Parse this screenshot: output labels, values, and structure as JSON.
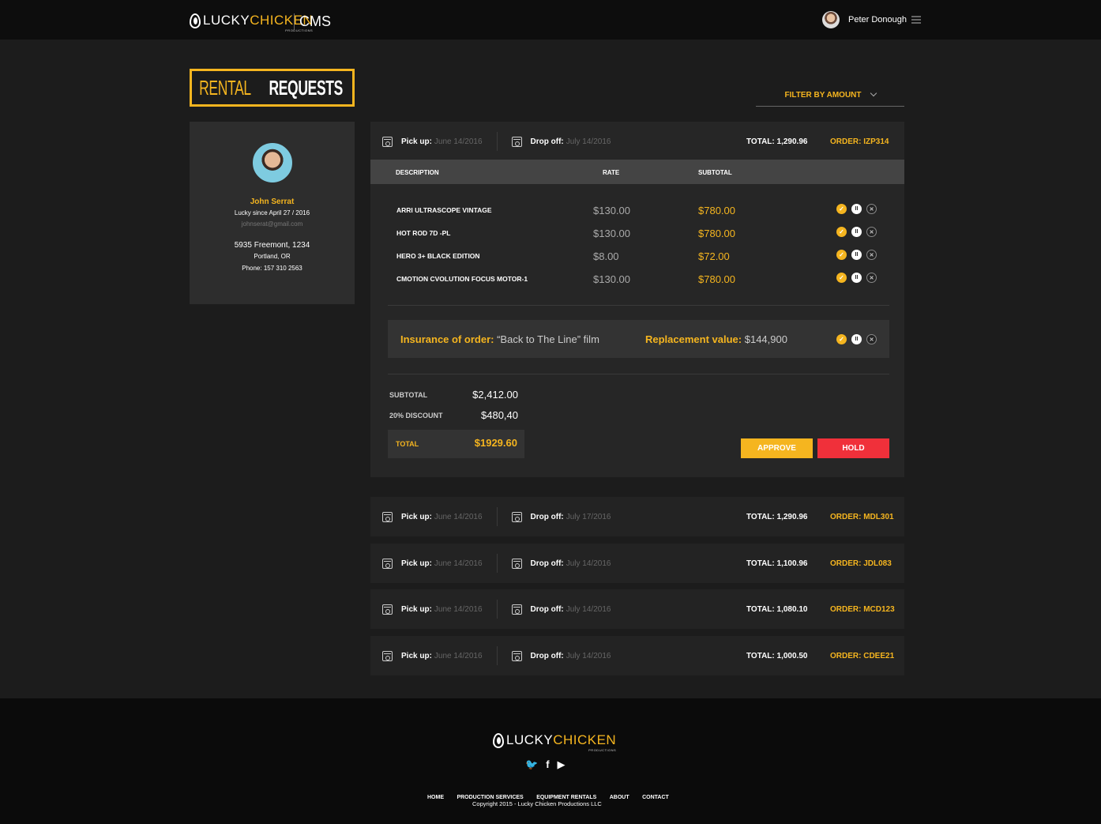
{
  "nav": {
    "logo_lucky": "LUCKY",
    "logo_chicken": "CHICKEN",
    "logo_productions": "PRODUCTIONS",
    "cms": "CMS",
    "user_name": "Peter Donough"
  },
  "page": {
    "title_light": "RENTAL",
    "title_bold": "REQUESTS",
    "filter_label": "FILTER BY AMOUNT"
  },
  "customer": {
    "name": "John Serrat",
    "since": "Lucky since April 27 / 2016",
    "email": "johnserat@gmail.com",
    "address": "5935 Freemont, 1234",
    "city": "Portland, OR",
    "phone": "Phone: 157 310 2563"
  },
  "labels": {
    "pickup": "Pick up:",
    "dropoff": "Drop off:",
    "desc": "DESCRIPTION",
    "rate": "RATE",
    "subtotal": "SUBTOTAL",
    "insurance_label": "Insurance of order:",
    "insurance_value": "“Back to The Line” film",
    "replacement_label": "Replacement value:",
    "replacement_value": "$144,900",
    "sum_subtotal": "SUBTOTAL",
    "sum_discount": "20% DISCOUNT",
    "sum_total": "TOTAL",
    "approve": "APPROVE",
    "hold": "HOLD"
  },
  "expanded_order": {
    "pickup_date": "June 14/2016",
    "dropoff_date": "July 14/2016",
    "total": "TOTAL: 1,290.96",
    "order": "ORDER: IZP314",
    "items": [
      {
        "desc": "ARRI ULTRASCOPE VINTAGE",
        "rate": "$130.00",
        "subtotal": "$780.00"
      },
      {
        "desc": "HOT ROD 7D -PL",
        "rate": "$130.00",
        "subtotal": "$780.00"
      },
      {
        "desc": "HERO 3+ BLACK EDITION",
        "rate": "$8.00",
        "subtotal": "$72.00"
      },
      {
        "desc": "CMOTION CVOLUTION FOCUS MOTOR-1",
        "rate": "$130.00",
        "subtotal": "$780.00"
      }
    ],
    "subtotal": "$2,412.00",
    "discount": "$480,40",
    "grand_total": "$1929.60"
  },
  "orders": [
    {
      "pickup_date": "June 14/2016",
      "dropoff_date": "July 17/2016",
      "total": "TOTAL: 1,290.96",
      "order": "ORDER: MDL301"
    },
    {
      "pickup_date": "June 14/2016",
      "dropoff_date": "July 14/2016",
      "total": "TOTAL: 1,100.96",
      "order": "ORDER: JDL083"
    },
    {
      "pickup_date": "June 14/2016",
      "dropoff_date": "July 14/2016",
      "total": "TOTAL: 1,080.10",
      "order": "ORDER: MCD123"
    },
    {
      "pickup_date": "June 14/2016",
      "dropoff_date": "July 14/2016",
      "total": "TOTAL: 1,000.50",
      "order": "ORDER: CDEE21"
    }
  ],
  "footer": {
    "links": [
      "HOME",
      "PRODUCTION SERVICES",
      "EQUIPMENT RENTALS",
      "ABOUT",
      "CONTACT"
    ],
    "copyright": "Copyright 2015 - Lucky Chicken Productions LLC",
    "social_icons": [
      "twitter-icon",
      "facebook-icon",
      "youtube-icon"
    ]
  },
  "colors": {
    "accent": "#f5b51f",
    "hold": "#f0303a",
    "background": "#1c1c1c"
  }
}
